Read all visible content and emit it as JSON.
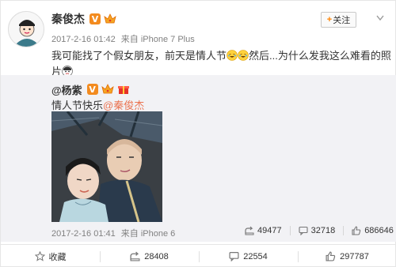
{
  "post": {
    "author": "秦俊杰",
    "verified_badge": "V",
    "meta": {
      "date": "2017-2-16 01:42",
      "source_prefix": "来自",
      "device": "iPhone 7 Plus"
    },
    "follow_label": "关注",
    "text_1": "我可能找了个假女朋友，前天是情人节",
    "text_2": "然后...为什么发我这么难看的照片"
  },
  "repost": {
    "author": "@杨紫",
    "text": "情人节快乐",
    "mention": "@秦俊杰",
    "meta": {
      "date": "2017-2-16 01:41",
      "source_prefix": "来自",
      "device": "iPhone 6"
    },
    "stats": {
      "forward": "49477",
      "comment": "32718",
      "like": "686646"
    }
  },
  "actions": {
    "favorite": "收藏",
    "forward": "28408",
    "comment": "22554",
    "like": "297787"
  },
  "colors": {
    "accent": "#ff8200",
    "mention": "#eb7350",
    "repost_bg": "#f2f2f5"
  }
}
